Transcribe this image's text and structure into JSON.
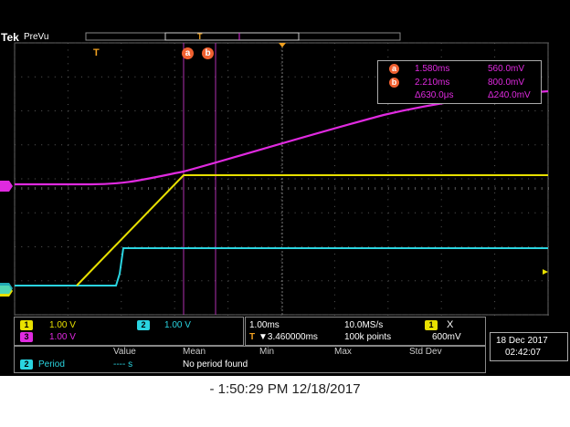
{
  "header": {
    "brand": "Tek",
    "mode": "PreVu",
    "trigger_marker": "T"
  },
  "cursors": {
    "a_label": "a",
    "b_label": "b",
    "readout": {
      "a_time": "1.580ms",
      "a_volt": "560.0mV",
      "b_time": "2.210ms",
      "b_volt": "800.0mV",
      "delta_time": "Δ630.0μs",
      "delta_volt": "Δ240.0mV"
    }
  },
  "channels": {
    "ch1": {
      "id": "1",
      "scale": "1.00 V",
      "color": "#e8e000"
    },
    "ch2": {
      "id": "2",
      "scale": "1.00 V",
      "color": "#2ad4e0"
    },
    "ch3": {
      "id": "3",
      "scale": "1.00 V",
      "color": "#e02ae0"
    }
  },
  "timebase": {
    "scale": "1.00ms",
    "sample_rate": "10.0MS/s",
    "delay": "▼3.460000ms",
    "record": "100k points",
    "trigger_channel": "1",
    "trigger_level": "600mV",
    "trigger_symbol": "X"
  },
  "datetime": {
    "date": "18 Dec  2017",
    "time": "02:42:07"
  },
  "measurement": {
    "headers": [
      "Value",
      "Mean",
      "Min",
      "Max",
      "Std Dev"
    ],
    "channel": "2",
    "name": "Period",
    "value": "----  s",
    "message": "No period found"
  },
  "caption": "- 1:50:29 PM    12/18/2017"
}
